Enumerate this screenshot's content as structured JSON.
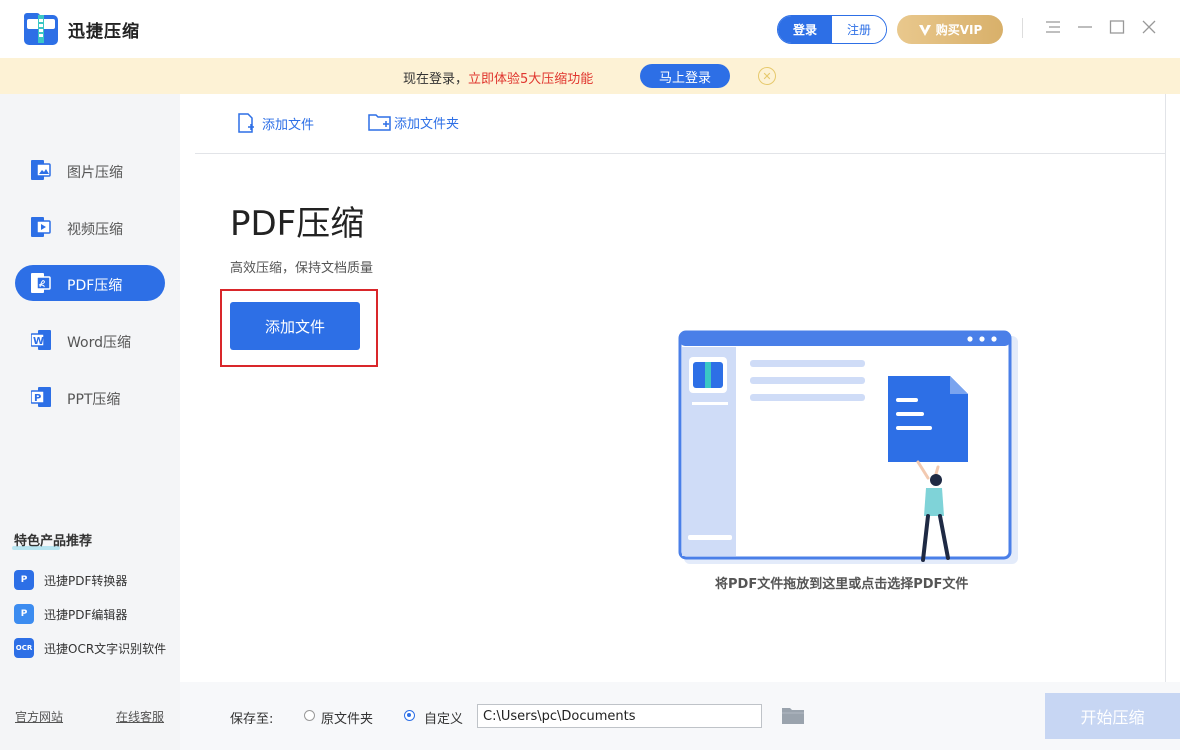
{
  "app": {
    "title": "迅捷压缩",
    "accent_color": "#2d6fe6"
  },
  "header": {
    "login_label": "登录",
    "register_label": "注册",
    "vip_label": "购买VIP",
    "controls": [
      "menu-icon",
      "minimize-icon",
      "maximize-icon",
      "close-icon"
    ]
  },
  "banner": {
    "text_prefix": "现在登录，",
    "text_highlight": "立即体验5大压缩功能",
    "login_button": "马上登录"
  },
  "sidebar": {
    "items": [
      {
        "label": "图片压缩",
        "icon": "image-icon",
        "active": false
      },
      {
        "label": "视频压缩",
        "icon": "video-icon",
        "active": false
      },
      {
        "label": "PDF压缩",
        "icon": "pdf-icon",
        "active": true
      },
      {
        "label": "Word压缩",
        "icon": "word-icon",
        "active": false
      },
      {
        "label": "PPT压缩",
        "icon": "ppt-icon",
        "active": false
      }
    ],
    "recommend_title": "特色产品推荐",
    "recommend_items": [
      {
        "label": "迅捷PDF转换器",
        "icon": "pdf-converter-icon"
      },
      {
        "label": "迅捷PDF编辑器",
        "icon": "pdf-editor-icon"
      },
      {
        "label": "迅捷OCR文字识别软件",
        "icon": "ocr-icon",
        "badge": "OCR"
      }
    ],
    "footer": {
      "website": "官方网站",
      "support": "在线客服"
    }
  },
  "toolbar": {
    "add_file": "添加文件",
    "add_folder": "添加文件夹"
  },
  "main": {
    "heading": "PDF压缩",
    "subtitle": "高效压缩，保持文档质量",
    "add_file_button": "添加文件",
    "drop_hint": "将PDF文件拖放到这里或点击选择PDF文件"
  },
  "bottom": {
    "save_label": "保存至:",
    "option_original": "原文件夹",
    "option_custom": "自定义",
    "selected_option": "自定义",
    "path_value": "C:\\Users\\pc\\Documents",
    "start_button": "开始压缩"
  }
}
